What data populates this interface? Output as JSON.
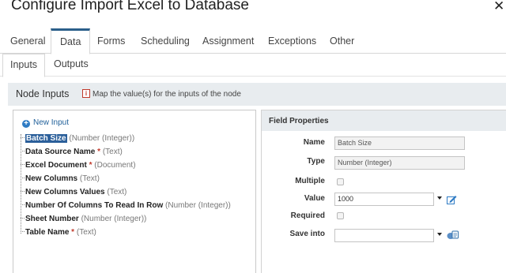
{
  "window": {
    "title": "Configure Import Excel to Database",
    "close_glyph": "✕"
  },
  "tabs": [
    {
      "label": "General"
    },
    {
      "label": "Data"
    },
    {
      "label": "Forms"
    },
    {
      "label": "Scheduling"
    },
    {
      "label": "Assignment"
    },
    {
      "label": "Exceptions"
    },
    {
      "label": "Other"
    }
  ],
  "active_tab": "Data",
  "subtabs": [
    {
      "label": "Inputs"
    },
    {
      "label": "Outputs"
    }
  ],
  "active_subtab": "Inputs",
  "node_inputs": {
    "title": "Node Inputs",
    "info_glyph": "i",
    "hint": "Map the value(s) for the inputs of the node",
    "new_input_label": "New Input",
    "plus_glyph": "+",
    "items": [
      {
        "name": "Batch Size",
        "required": "",
        "type": "(Number (Integer))",
        "selected": true
      },
      {
        "name": "Data Source Name",
        "required": "*",
        "type": "(Text)",
        "selected": false
      },
      {
        "name": "Excel Document",
        "required": "*",
        "type": "(Document)",
        "selected": false
      },
      {
        "name": "New Columns",
        "required": "",
        "type": "(Text)",
        "selected": false
      },
      {
        "name": "New Columns Values",
        "required": "",
        "type": "(Text)",
        "selected": false
      },
      {
        "name": "Number Of Columns To Read In Row",
        "required": "",
        "type": "(Number (Integer))",
        "selected": false
      },
      {
        "name": "Sheet Number",
        "required": "",
        "type": "(Number (Integer))",
        "selected": false
      },
      {
        "name": "Table Name",
        "required": "*",
        "type": "(Text)",
        "selected": false
      }
    ]
  },
  "field_properties": {
    "title": "Field Properties",
    "name_label": "Name",
    "name_value": "Batch Size",
    "type_label": "Type",
    "type_value": "Number (Integer)",
    "multiple_label": "Multiple",
    "multiple_checked": false,
    "value_label": "Value",
    "value_value": "1000",
    "required_label": "Required",
    "required_checked": false,
    "save_into_label": "Save into",
    "save_into_value": ""
  },
  "colors": {
    "accent": "#2b5f8a",
    "selection": "#2b5f9a",
    "required": "#c0392b",
    "link": "#1f5f99"
  },
  "icons": {
    "close": "close-icon",
    "info": "info-icon",
    "new_input": "plus-circle-icon",
    "value_edit": "edit-pencil-icon",
    "save_into": "variable-picker-icon",
    "dropdown": "chevron-down-icon"
  }
}
